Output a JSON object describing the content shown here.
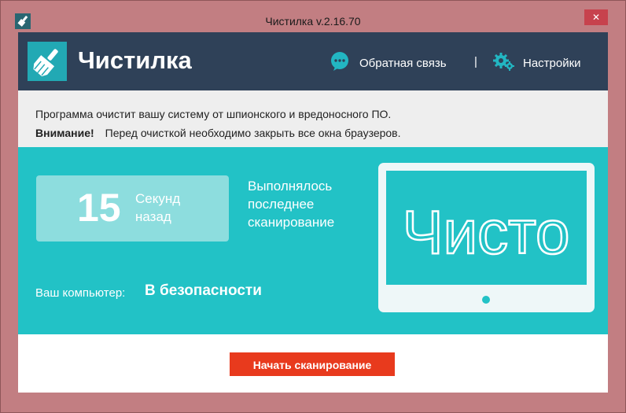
{
  "window": {
    "title": "Чистилка v.2.16.70",
    "close_glyph": "✕"
  },
  "header": {
    "app_name": "Чистилка",
    "logo_icon": "broom-icon",
    "feedback_icon": "chat-bubble-icon",
    "feedback_label": "Обратная связь",
    "separator": "|",
    "settings_icon": "gears-icon",
    "settings_label": "Настройки"
  },
  "notice": {
    "line1": "Программа очистит вашу систему от шпионского и вредоносного ПО.",
    "attention_label": "Внимание!",
    "line2": "Перед очисткой необходимо закрыть все окна браузеров."
  },
  "status": {
    "seconds_ago": "15",
    "unit_line1": "Секунд",
    "unit_line2": "назад",
    "last_scan_line1": "Выполнялось",
    "last_scan_line2": "последнее",
    "last_scan_line3": "сканирование",
    "pc_label": "Ваш компьютер:",
    "pc_status": "В безопасности",
    "screen_text": "Чисто"
  },
  "footer": {
    "scan_button": "Начать сканирование"
  },
  "colors": {
    "header_bg": "#2f4158",
    "accent_teal": "#22c2c6",
    "button_red": "#e83a1d",
    "window_frame": "#c27e82"
  }
}
